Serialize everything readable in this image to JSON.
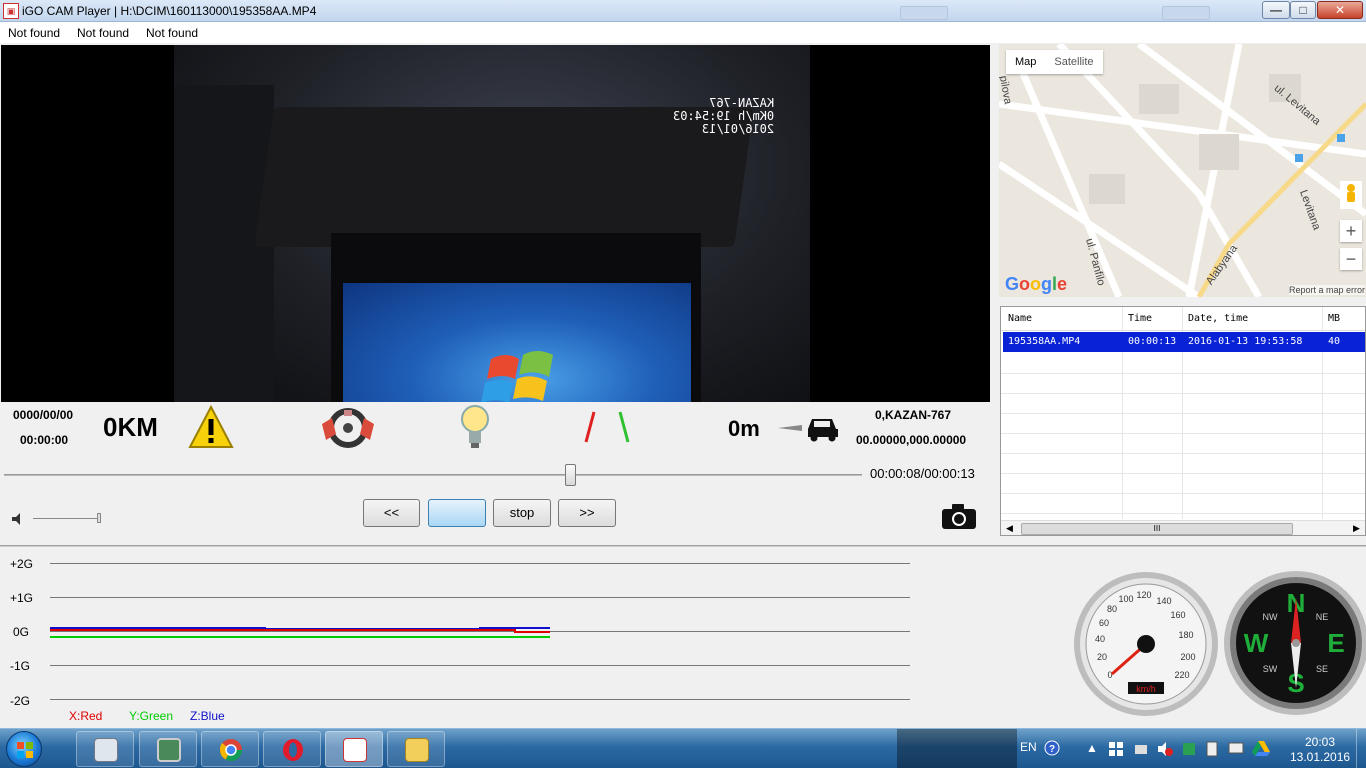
{
  "window": {
    "title": "iGO CAM Player | H:\\DCIM\\160113000\\195358AA.MP4",
    "controls": {
      "minimize": "—",
      "maximize": "□",
      "close": "✕"
    }
  },
  "menu": [
    "Not found",
    "Not found",
    "Not found"
  ],
  "video": {
    "overlay_line1": "KAZAN-767",
    "overlay_line2": "0Km/h 19:54:03",
    "overlay_line3": "2016/01/13"
  },
  "info": {
    "date": "0000/00/00",
    "time": "00:00:00",
    "speed": "0KM",
    "distance": "0m",
    "device": "0,KAZAN-767",
    "coords": "00.00000,000.00000"
  },
  "icons": {
    "warning": "warning-icon",
    "steering": "steering-wheel-icon",
    "bulb": "light-bulb-icon",
    "car": "car-icon",
    "camera": "camera-icon",
    "speaker": "speaker-icon"
  },
  "playback": {
    "progress": 0.66,
    "position": "00:00:08",
    "duration": "00:00:13",
    "readout": "00:00:08/00:00:13",
    "prev_label": "<<",
    "play_label": "",
    "stop_label": "stop",
    "next_label": ">>",
    "volume": 1.0
  },
  "map": {
    "tab_map": "Map",
    "tab_satellite": "Satellite",
    "labels": [
      "ul. Levitana",
      "Levitana",
      "Alabyana",
      "ul. Panfilo",
      "pilova"
    ],
    "zoom_in": "+",
    "zoom_out": "−",
    "brand": "Google",
    "report": "Report a map error"
  },
  "files": {
    "columns": [
      "Name",
      "Time",
      "Date, time",
      "MB"
    ],
    "rows": [
      {
        "name": "195358AA.MP4",
        "time": "00:00:13",
        "datetime": "2016-01-13 19:53:58",
        "mb": "40"
      }
    ],
    "scroll_grip": "III"
  },
  "graph": {
    "y_labels": [
      "+2G",
      "+1G",
      "0G",
      "-1G",
      "-2G"
    ],
    "legend": [
      {
        "label": "X:Red",
        "color": "#e00000"
      },
      {
        "label": "Y:Green",
        "color": "#00cc00"
      },
      {
        "label": "Z:Blue",
        "color": "#1010cc"
      }
    ]
  },
  "speedometer": {
    "ticks": [
      "0",
      "20",
      "40",
      "60",
      "80",
      "100",
      "120",
      "140",
      "160",
      "180",
      "200",
      "220"
    ],
    "unit": "km/h",
    "value": 0
  },
  "compass": {
    "letters": [
      "N",
      "E",
      "S",
      "W"
    ],
    "minor": [
      "NE",
      "SE",
      "SW",
      "NW"
    ]
  },
  "taskbar": {
    "lang": "EN",
    "clock_time": "20:03",
    "clock_date": "13.01.2016"
  },
  "colors": {
    "selection": "#0a22d6",
    "title_gradient": "#c2d6ee",
    "taskbar": "#2c6aa4"
  }
}
